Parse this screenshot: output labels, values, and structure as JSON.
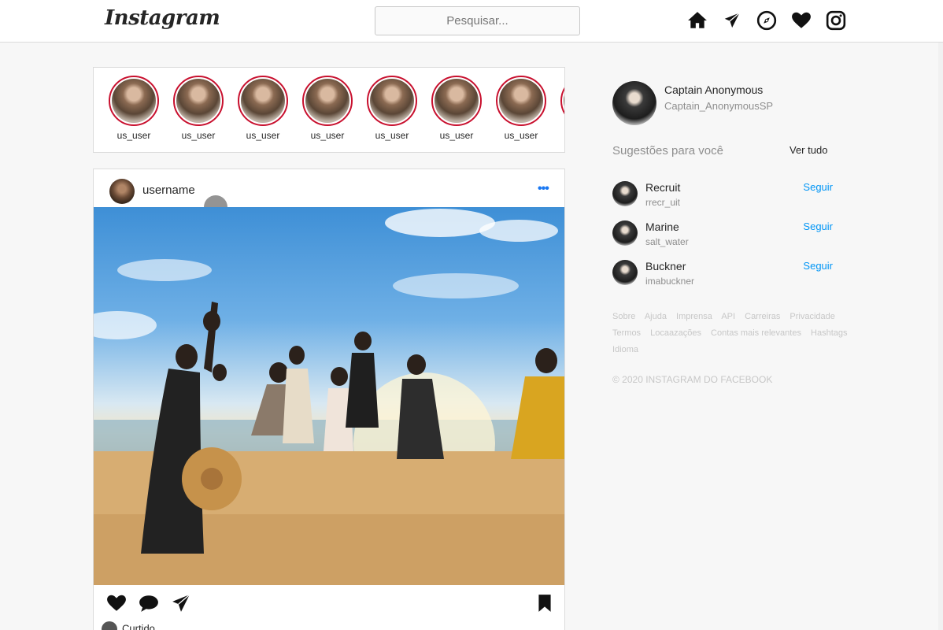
{
  "header": {
    "logo_text": "Instagram",
    "search_placeholder": "Pesquisar...",
    "icons": [
      "home-icon",
      "direct-send-icon",
      "explore-compass-icon",
      "activity-heart-icon",
      "instagram-camera-icon"
    ]
  },
  "stories": {
    "items": [
      {
        "label": "us_user"
      },
      {
        "label": "us_user"
      },
      {
        "label": "us_user"
      },
      {
        "label": "us_user"
      },
      {
        "label": "us_user"
      },
      {
        "label": "us_user"
      },
      {
        "label": "us_user"
      },
      {
        "label": ""
      }
    ],
    "ring_color": "#c8102e"
  },
  "post": {
    "username": "username",
    "more_label": "•••",
    "footer_text": "Curtido"
  },
  "profile": {
    "name": "Captain Anonymous",
    "handle": "Captain_AnonymousSP"
  },
  "suggestions": {
    "title": "Sugestões para você",
    "see_all": "Ver tudo",
    "follow_label": "Seguir",
    "items": [
      {
        "name": "Recruit",
        "handle": "rrecr_uit"
      },
      {
        "name": "Marine",
        "handle": "salt_water"
      },
      {
        "name": "Buckner",
        "handle": "imabuckner"
      }
    ]
  },
  "footer": {
    "links": [
      "Sobre",
      "Ajuda",
      "Imprensa",
      "API",
      "Carreiras",
      "Privacidade",
      "Termos",
      "Locaazações",
      "Contas mais relevantes",
      "Hashtags",
      "Idioma"
    ],
    "copyright": "© 2020 INSTAGRAM DO FACEBOOK"
  },
  "colors": {
    "accent_blue": "#0095f6",
    "text_primary": "#262626",
    "text_secondary": "#8e8e8e",
    "border": "#dbdbdb"
  }
}
